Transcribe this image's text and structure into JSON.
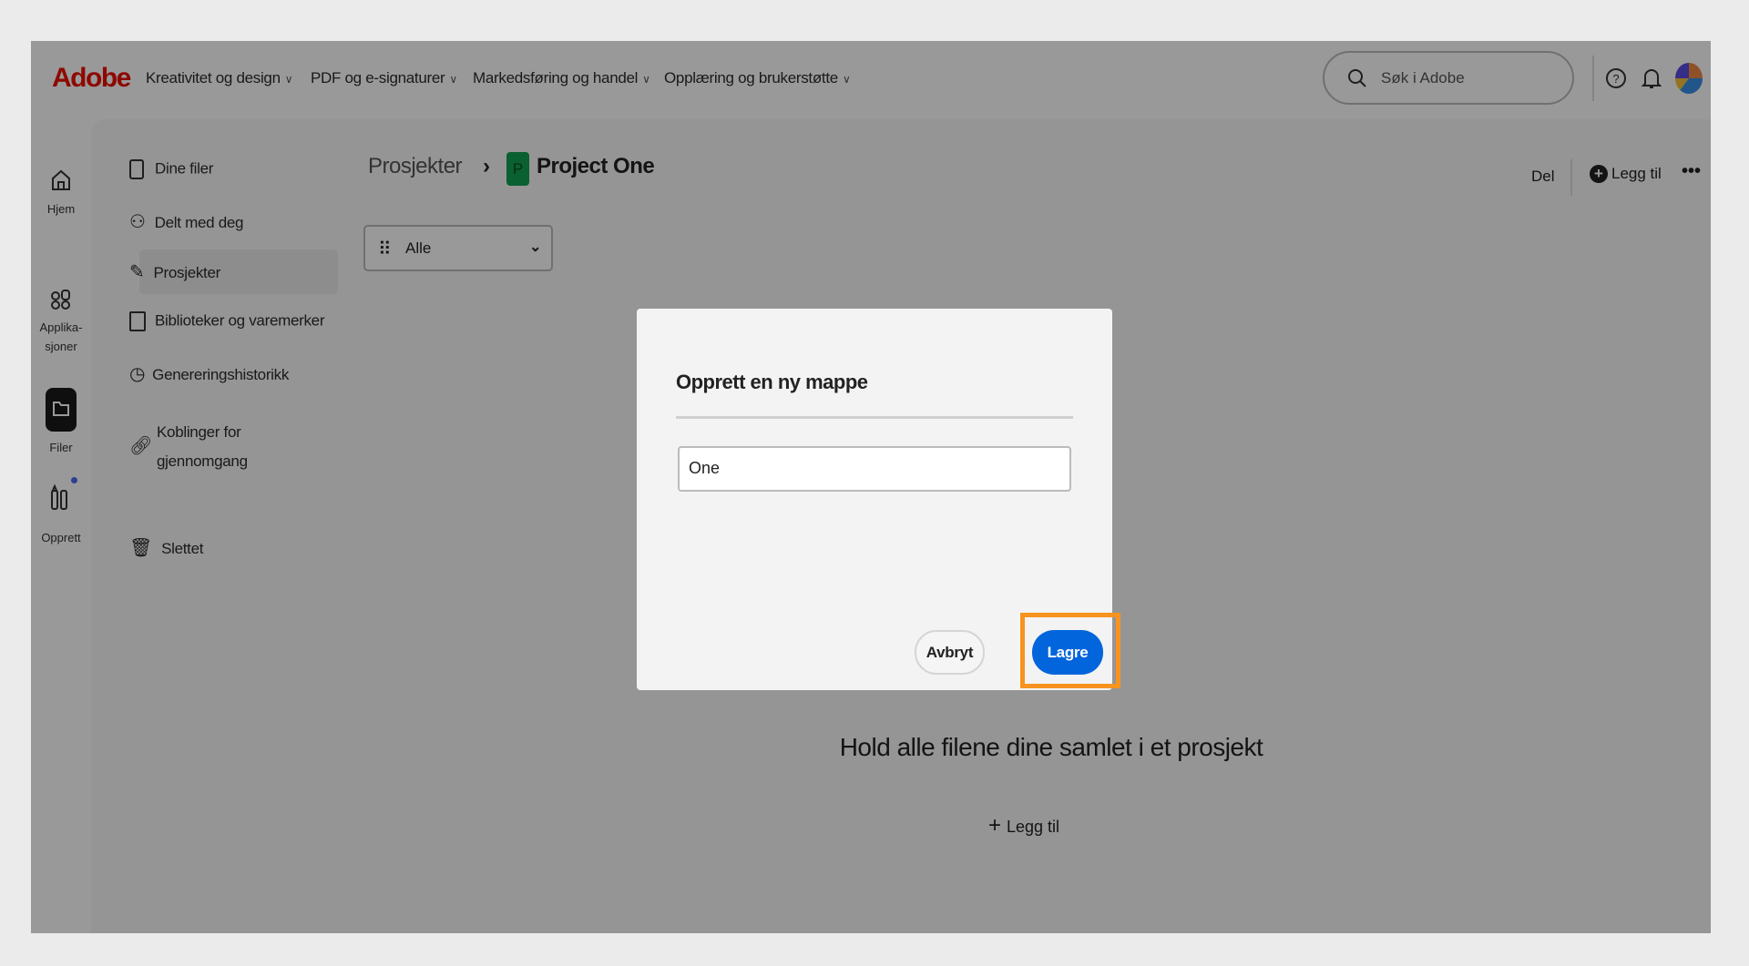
{
  "header": {
    "logo": "Adobe",
    "nav": [
      "Kreativitet og design",
      "PDF og e-signaturer",
      "Markedsføring og handel",
      "Opplæring og brukerstøtte"
    ],
    "search_placeholder": "Søk i Adobe"
  },
  "rail": {
    "items": [
      "Hjem",
      "Applika-",
      "sjoner",
      "Filer",
      "Opprett"
    ]
  },
  "sidebar": {
    "items": [
      "Dine filer",
      "Delt med deg",
      "Prosjekter",
      "Biblioteker og varemerker",
      "Genereringshistorikk",
      "Koblinger for",
      "gjennomgang",
      "Slettet"
    ]
  },
  "breadcrumb": {
    "parent": "Prosjekter",
    "badge": "P",
    "current": "Project One"
  },
  "filter": {
    "selected": "Alle"
  },
  "toolbar": {
    "share": "Del",
    "add": "Legg til"
  },
  "empty": {
    "message": "Hold alle filene dine samlet i et prosjekt",
    "add": "Legg til"
  },
  "dialog": {
    "title": "Opprett en ny mappe",
    "input_value": "One",
    "cancel": "Avbryt",
    "save": "Lagre"
  },
  "colors": {
    "brand": "#eb1000",
    "primary": "#0265dc",
    "highlight": "#f7931e",
    "project_badge": "#12a150"
  }
}
